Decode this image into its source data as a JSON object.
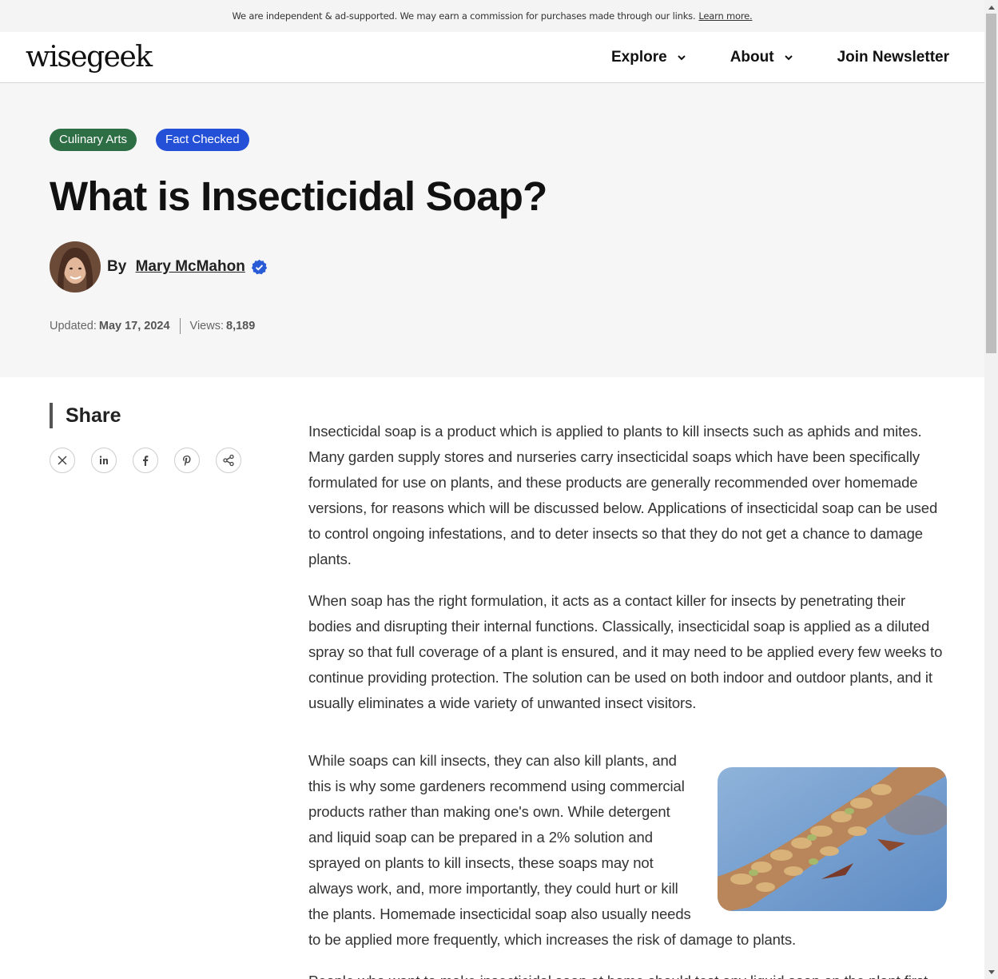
{
  "topbar": {
    "text": "We are independent & ad-supported. We may earn a commission for purchases made through our links.",
    "link": "Learn more."
  },
  "header": {
    "logo": "wisegeek",
    "nav": [
      {
        "label": "Explore"
      },
      {
        "label": "About"
      },
      {
        "label": "Join Newsletter"
      }
    ]
  },
  "hero": {
    "tags": [
      "Culinary Arts",
      "Fact Checked"
    ],
    "title": "What is Insecticidal Soap?",
    "by": "By",
    "author": "Mary McMahon",
    "updated_label": "Updated:",
    "updated_date": "May 17, 2024",
    "views_label": "Views:",
    "views": "8,189"
  },
  "share": {
    "title": "Share",
    "icons": [
      "x-icon",
      "linkedin-icon",
      "facebook-icon",
      "pinterest-icon",
      "share-icon"
    ]
  },
  "article": {
    "paragraphs": [
      "Insecticidal soap is a product which is applied to plants to kill insects such as aphids and mites. Many garden supply stores and nurseries carry insecticidal soaps which have been specifically formulated for use on plants, and these products are generally recommended over homemade versions, for reasons which will be discussed below. Applications of insecticidal soap can be used to control ongoing infestations, and to deter insects so that they do not get a chance to damage plants.",
      "When soap has the right formulation, it acts as a contact killer for insects by penetrating their bodies and disrupting their internal functions. Classically, insecticidal soap is applied as a diluted spray so that full coverage of a plant is ensured, and it may need to be applied every few weeks to continue providing protection. The solution can be used on both indoor and outdoor plants, and it usually eliminates a wide variety of unwanted insect visitors.",
      "While soaps can kill insects, they can also kill plants, and this is why some gardeners recommend using commercial products rather than making one's own. While detergent and liquid soap can be prepared in a 2% solution and sprayed on plants to kill insects, these soaps may not always work, and, more importantly, they could hurt or kill the plants. Homemade insecticidal soap also usually needs to be applied more frequently, which increases the risk of damage to plants.",
      "People who want to make insecticidal soap at home should test any liquid soap on the plant first."
    ]
  },
  "colors": {
    "tag_green": "#2e6e45",
    "tag_blue": "#2450d8",
    "hero_bg": "#f6f6f6",
    "verified": "#2a5bd7"
  }
}
